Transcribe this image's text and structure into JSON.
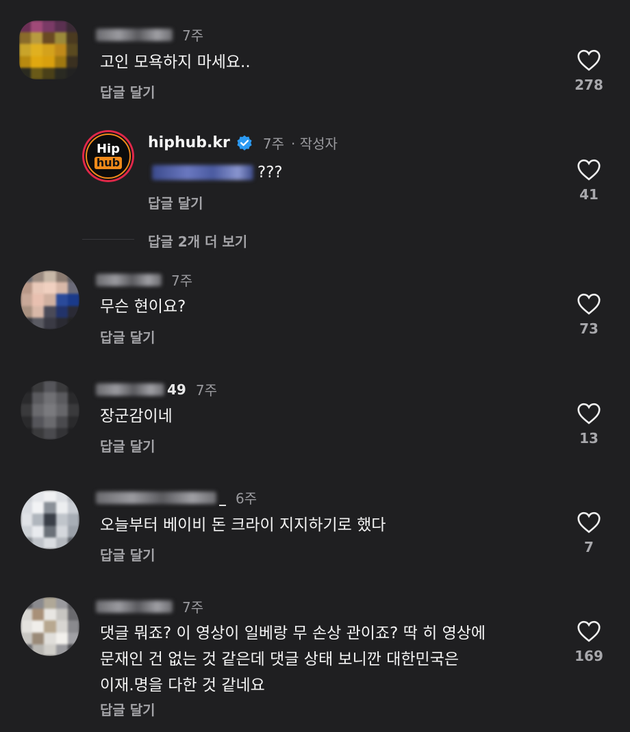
{
  "accent_color": "#2b9af3",
  "like_icon": "heart-outline-icon",
  "reply_label": "답글 달기",
  "comments": [
    {
      "name_suffix": "",
      "time": "7주",
      "text": "고인 모욕하지 마세요..",
      "likes": "278"
    },
    {
      "author": "hiphub.kr",
      "avatar_line1": "Hip",
      "avatar_line2": "hub",
      "time": "7주",
      "author_tag": "· 작성자",
      "text": "???",
      "likes": "41",
      "more_replies": "답글 2개 더 보기"
    },
    {
      "name_suffix": "",
      "time": "7주",
      "text": "무슨 현이요?",
      "likes": "73"
    },
    {
      "name_suffix": "49",
      "time": "7주",
      "text": "장군감이네",
      "likes": "13"
    },
    {
      "name_suffix": "_",
      "time": "6주",
      "text": "오늘부터 베이비 돈 크라이 지지하기로 했다",
      "likes": "7"
    },
    {
      "name_suffix": "",
      "time": "7주",
      "text_lines": [
        "댓글 뭐죠? 이 영상이 일베랑 무 손상 관이죠? 딱 히 영상에",
        "문재인 건 없는 것 같은데 댓글 상태 보니깐 대한민국은",
        "이재.명을 다한 것 같네요"
      ],
      "likes": "169"
    }
  ]
}
